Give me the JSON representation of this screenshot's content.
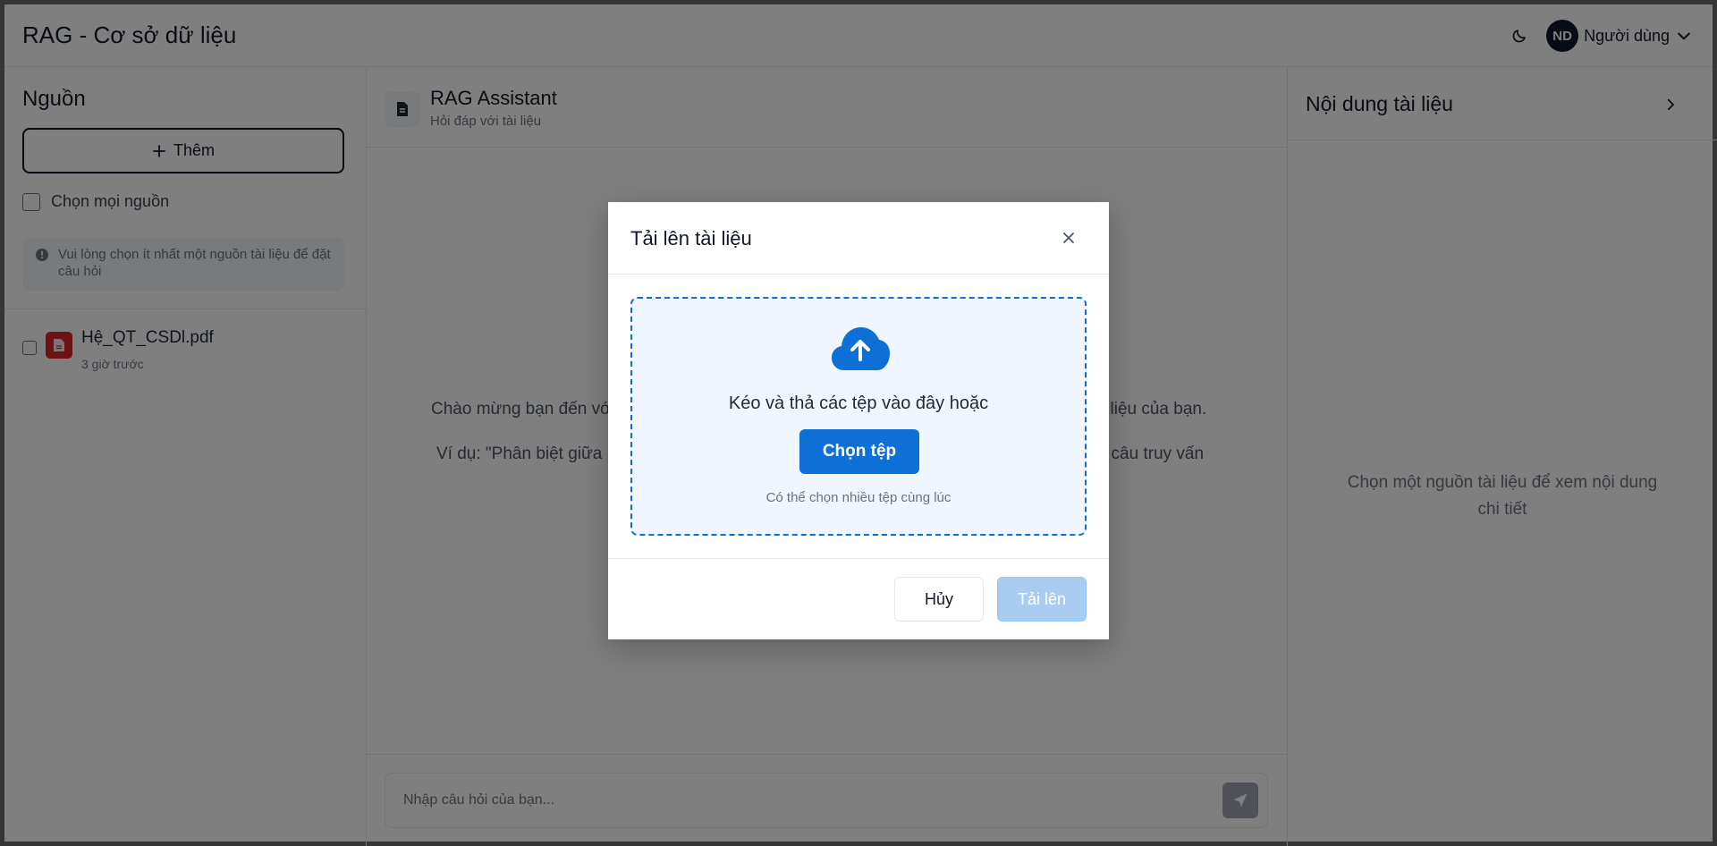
{
  "header": {
    "title": "RAG - Cơ sở dữ liệu",
    "theme_icon": "moon-icon",
    "user": {
      "initials": "ND",
      "name": "Người dùng"
    }
  },
  "sidebar": {
    "title": "Nguồn",
    "add_label": "Thêm",
    "select_all_label": "Chọn mọi nguồn",
    "info_text": "Vui lòng chọn ít nhất một nguồn tài liệu để đặt câu hỏi",
    "files": [
      {
        "name": "Hệ_QT_CSDl.pdf",
        "time": "3 giờ trước"
      }
    ]
  },
  "main": {
    "title": "RAG Assistant",
    "subtitle": "Hỏi đáp với tài liệu",
    "welcome_left": "Chào mừng bạn đến vớ",
    "welcome_right": "i liệu của bạn.",
    "example_left": "Ví dụ: \"Phân biệt giữa",
    "example_right": "t câu truy vấn",
    "composer_placeholder": "Nhập câu hỏi của bạn..."
  },
  "right_panel": {
    "title": "Nội dung tài liệu",
    "empty_text": "Chọn một nguồn tài liệu để xem nội dung chi tiết"
  },
  "modal": {
    "title": "Tải lên tài liệu",
    "drop_text": "Kéo và thả các tệp vào đây hoặc",
    "choose_label": "Chọn tệp",
    "multi_text": "Có thể chọn nhiều tệp cùng lúc",
    "cancel_label": "Hủy",
    "upload_label": "Tải lên"
  },
  "colors": {
    "primary": "#0e6fd6",
    "upload_disabled": "#a8cdf0",
    "file_pdf": "#dc2626"
  }
}
